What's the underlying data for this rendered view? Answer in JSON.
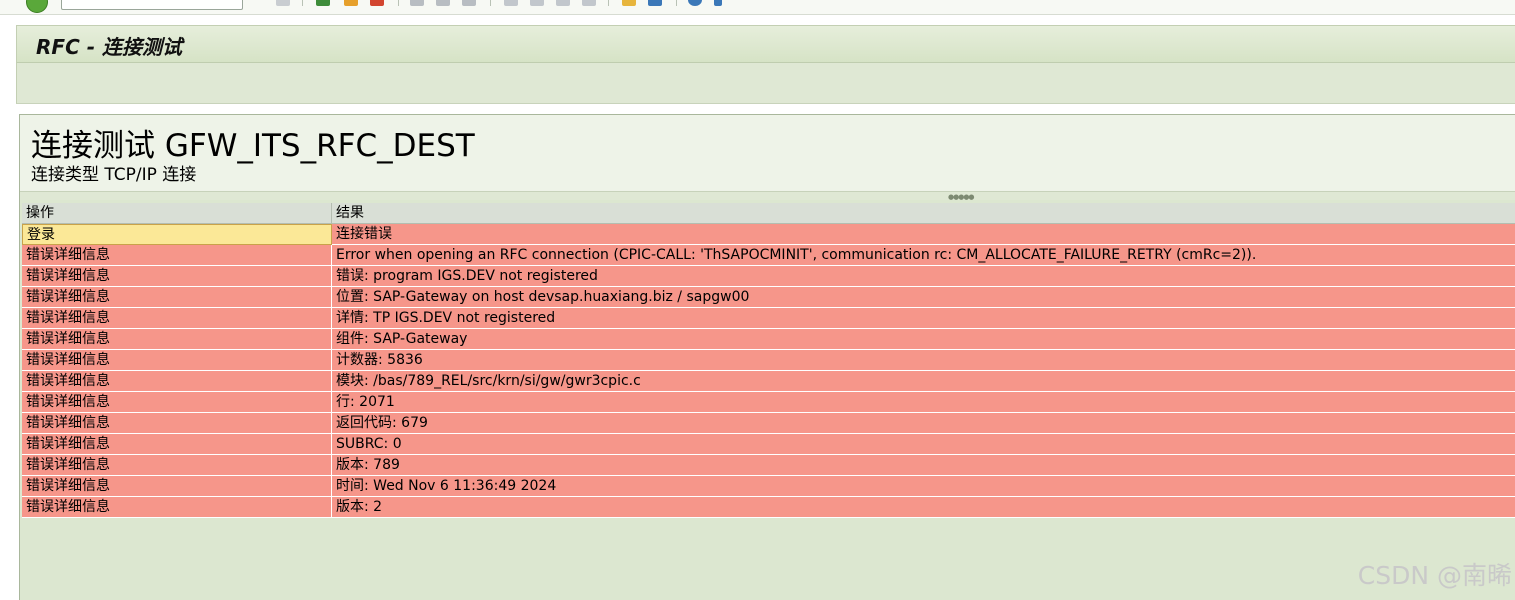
{
  "window_title": "RFC - 连接测试",
  "heading": "连接测试 GFW_ITS_RFC_DEST",
  "subheading": "连接类型 TCP/IP 连接",
  "table": {
    "headers": [
      "操作",
      "结果"
    ],
    "rows": [
      {
        "action": "登录",
        "result": "连接错误"
      },
      {
        "action": "错误详细信息",
        "result": "Error when opening an RFC connection (CPIC-CALL: 'ThSAPOCMINIT', communication rc: CM_ALLOCATE_FAILURE_RETRY (cmRc=2))."
      },
      {
        "action": "错误详细信息",
        "result": "错误: program IGS.DEV not registered"
      },
      {
        "action": "错误详细信息",
        "result": "位置: SAP-Gateway on host devsap.huaxiang.biz / sapgw00"
      },
      {
        "action": "错误详细信息",
        "result": "详情: TP IGS.DEV not registered"
      },
      {
        "action": "错误详细信息",
        "result": "组件: SAP-Gateway"
      },
      {
        "action": "错误详细信息",
        "result": "计数器: 5836"
      },
      {
        "action": "错误详细信息",
        "result": "模块: /bas/789_REL/src/krn/si/gw/gwr3cpic.c"
      },
      {
        "action": "错误详细信息",
        "result": "行: 2071"
      },
      {
        "action": "错误详细信息",
        "result": "返回代码: 679"
      },
      {
        "action": "错误详细信息",
        "result": "SUBRC: 0"
      },
      {
        "action": "错误详细信息",
        "result": "版本: 789"
      },
      {
        "action": "错误详细信息",
        "result": "时间: Wed Nov  6 11:36:49 2024"
      },
      {
        "action": "错误详细信息",
        "result": "版本: 2"
      }
    ]
  },
  "watermark": "CSDN @南晞",
  "colors": {
    "error_row": "#f6968a",
    "selected_cell": "#fbe897",
    "background": "#dce7d0"
  },
  "toolbar_icons": [
    "ok-icon",
    "save-icon",
    "back-icon",
    "exit-icon",
    "cancel-icon",
    "print-icon",
    "find-icon",
    "first-page-icon",
    "prev-page-icon",
    "next-page-icon",
    "last-page-icon",
    "new-session-icon",
    "shortcut-icon",
    "help-icon",
    "layout-icon"
  ]
}
